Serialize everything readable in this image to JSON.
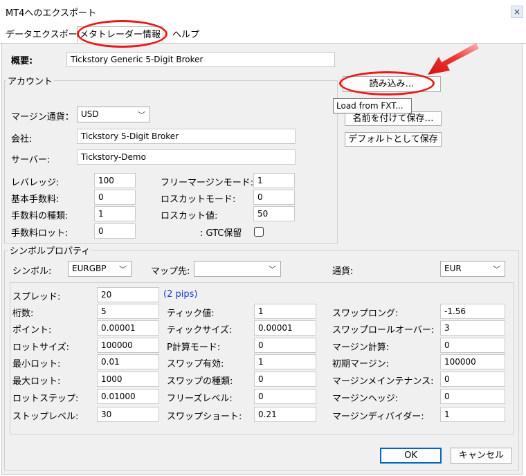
{
  "window": {
    "title": "MT4へのエクスポート",
    "close_label": "×"
  },
  "tabs": [
    "データエクスポート",
    "メタトレーダー情報",
    "ヘルプ"
  ],
  "overview": {
    "label": "概要:",
    "value": "Tickstory Generic 5-Digit Broker"
  },
  "account": {
    "group_title": "アカウント",
    "margin_currency_label": "マージン通貨：",
    "margin_currency_value": "USD",
    "company_label": "会社:",
    "company_value": "Tickstory 5-Digit Broker",
    "server_label": "サーバー:",
    "server_value": "Tickstory-Demo",
    "leverage_label": "レバレッジ:",
    "leverage_value": "100",
    "base_fee_label": "基本手数料:",
    "base_fee_value": "0",
    "fee_type_label": "手数料の種類:",
    "fee_type_value": "1",
    "fee_lot_label": "手数料ロット:",
    "fee_lot_value": "0",
    "free_margin_mode_label": "フリーマージンモード:",
    "free_margin_mode_value": "1",
    "stopout_mode_label": "ロスカットモード:",
    "stopout_mode_value": "0",
    "stopout_value_label": "ロスカット値:",
    "stopout_value_value": "50",
    "gtc_label": ": GTC保留"
  },
  "buttons": {
    "load": "読み込み…",
    "save_as": "名前を付けて保存…",
    "save_default": "デフォルトとして保存",
    "ok": "OK",
    "cancel": "キャンセル"
  },
  "tooltip": "Load from FXT...",
  "symbol": {
    "group_title": "シンボルプロパティ",
    "symbol_label": "シンボル:",
    "symbol_value": "EURGBP",
    "map_label": "マップ先:",
    "map_value": "",
    "currency_label": "通貨:",
    "currency_value": "EUR",
    "spread_label": "スプレッド:",
    "spread_value": "20",
    "spread_note": "(2 pips)",
    "rows_left": [
      {
        "label": "桁数:",
        "value": "5"
      },
      {
        "label": "ポイント:",
        "value": "0.00001"
      },
      {
        "label": "ロットサイズ:",
        "value": "100000"
      },
      {
        "label": "最小ロット:",
        "value": "0.01"
      },
      {
        "label": "最大ロット:",
        "value": "1000"
      },
      {
        "label": "ロットステップ:",
        "value": "0.01000"
      },
      {
        "label": "ストップレベル:",
        "value": "30"
      }
    ],
    "rows_mid": [
      {
        "label": "ティック値:",
        "value": "1"
      },
      {
        "label": "ティックサイズ:",
        "value": "0.00001"
      },
      {
        "label": "P計算モード:",
        "value": "0"
      },
      {
        "label": "スワップ有効:",
        "value": "1"
      },
      {
        "label": "スワップの種類:",
        "value": "0"
      },
      {
        "label": "フリーズレベル:",
        "value": "0"
      },
      {
        "label": "スワップショート:",
        "value": "0.21"
      }
    ],
    "rows_right": [
      {
        "label": "スワップロング:",
        "value": "-1.56"
      },
      {
        "label": "スワップロールオーバー:",
        "value": "3"
      },
      {
        "label": "マージン計算:",
        "value": "0"
      },
      {
        "label": "初期マージン:",
        "value": "100000"
      },
      {
        "label": "マージンメインテナンス:",
        "value": "0"
      },
      {
        "label": "マージンヘッジ:",
        "value": "0"
      },
      {
        "label": "マージンディバイダー:",
        "value": "1"
      }
    ]
  },
  "annotation_color": "#e81818"
}
